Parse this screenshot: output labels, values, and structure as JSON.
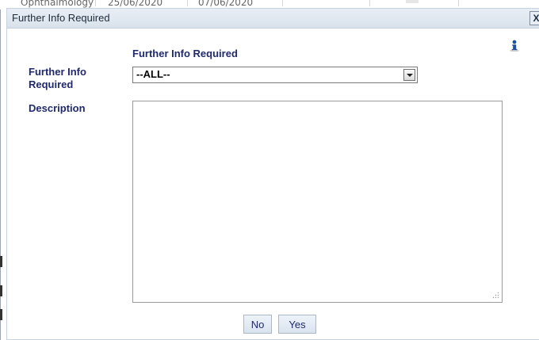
{
  "background": {
    "row_cells": [
      "Ophthalmology",
      "25/06/2020",
      "07/06/2020"
    ]
  },
  "dialog": {
    "title": "Further Info Required",
    "close_label": "X",
    "heading": "Further Info Required",
    "info_icon": "info-icon",
    "fields": {
      "further_info_label": "Further Info Required",
      "further_info_value": "--ALL--",
      "description_label": "Description",
      "description_value": ""
    },
    "buttons": {
      "no": "No",
      "yes": "Yes"
    }
  },
  "colors": {
    "label_text": "#1f2a6e",
    "titlebar": "#dfe6ef",
    "button_bg": "#e3eaf3"
  }
}
